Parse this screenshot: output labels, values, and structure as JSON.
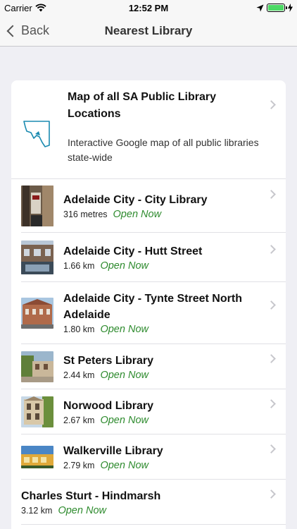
{
  "status_bar": {
    "carrier": "Carrier",
    "time": "12:52 PM",
    "battery_color": "#4cd964"
  },
  "nav": {
    "back_label": "Back",
    "title": "Nearest Library"
  },
  "map_item": {
    "title": "Map of all SA Public Library Locations",
    "description": "Interactive Google map of all public libraries state-wide",
    "icon": "sa-map-outline-icon"
  },
  "libraries": [
    {
      "name": "Adelaide City - City Library",
      "distance": "316 metres",
      "status": "Open Now"
    },
    {
      "name": "Adelaide City - Hutt Street",
      "distance": "1.66 km",
      "status": "Open Now"
    },
    {
      "name": "Adelaide City - Tynte Street North Adelaide",
      "distance": "1.80 km",
      "status": "Open Now"
    },
    {
      "name": "St Peters Library",
      "distance": "2.44 km",
      "status": "Open Now"
    },
    {
      "name": "Norwood Library",
      "distance": "2.67 km",
      "status": "Open Now"
    },
    {
      "name": "Walkerville Library",
      "distance": "2.79 km",
      "status": "Open Now"
    },
    {
      "name": "Charles Sturt - Hindmarsh",
      "distance": "3.12 km",
      "status": "Open Now"
    }
  ],
  "colors": {
    "open_status": "#2e8b2e",
    "nav_bg": "#f7f7f7",
    "page_bg": "#efeff4"
  }
}
